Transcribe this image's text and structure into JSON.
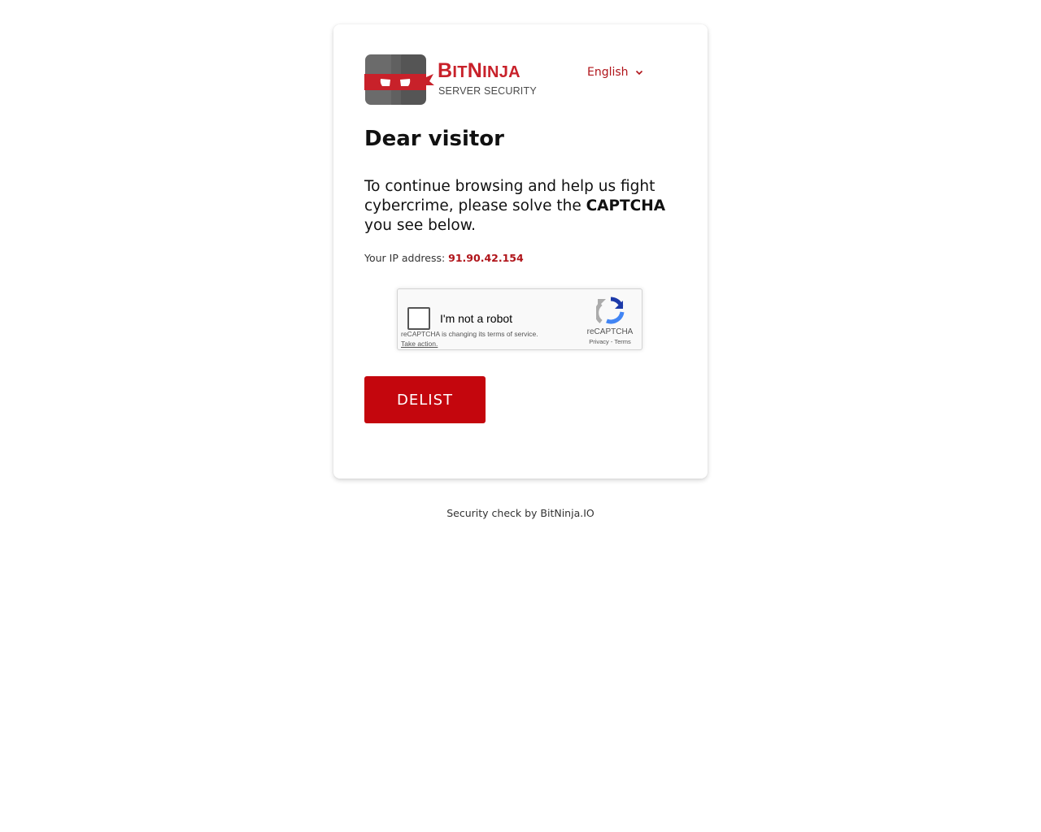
{
  "brand": {
    "name_first_cap": "B",
    "name_first_rest": "IT",
    "name_second_cap": "N",
    "name_second_rest": "INJA",
    "tagline": "SERVER SECURITY"
  },
  "language": {
    "selected": "English"
  },
  "content": {
    "title": "Dear visitor",
    "message_before": "To continue browsing and help us fight cybercrime, please solve the ",
    "message_bold": "CAPTCHA",
    "message_after": " you see below.",
    "ip_label": "Your IP address: ",
    "ip_value": "91.90.42.154"
  },
  "recaptcha": {
    "label": "I'm not a robot",
    "notice": "reCAPTCHA is changing its terms of service.",
    "action": "Take action.",
    "brand": "reCAPTCHA",
    "privacy": "Privacy",
    "separator": " - ",
    "terms": "Terms"
  },
  "actions": {
    "delist_label": "DELIST"
  },
  "footer": {
    "text": "Security check by BitNinja.IO"
  },
  "colors": {
    "brand_red": "#c8212a",
    "button_red": "#c4060d",
    "link_red": "#b0141a"
  }
}
